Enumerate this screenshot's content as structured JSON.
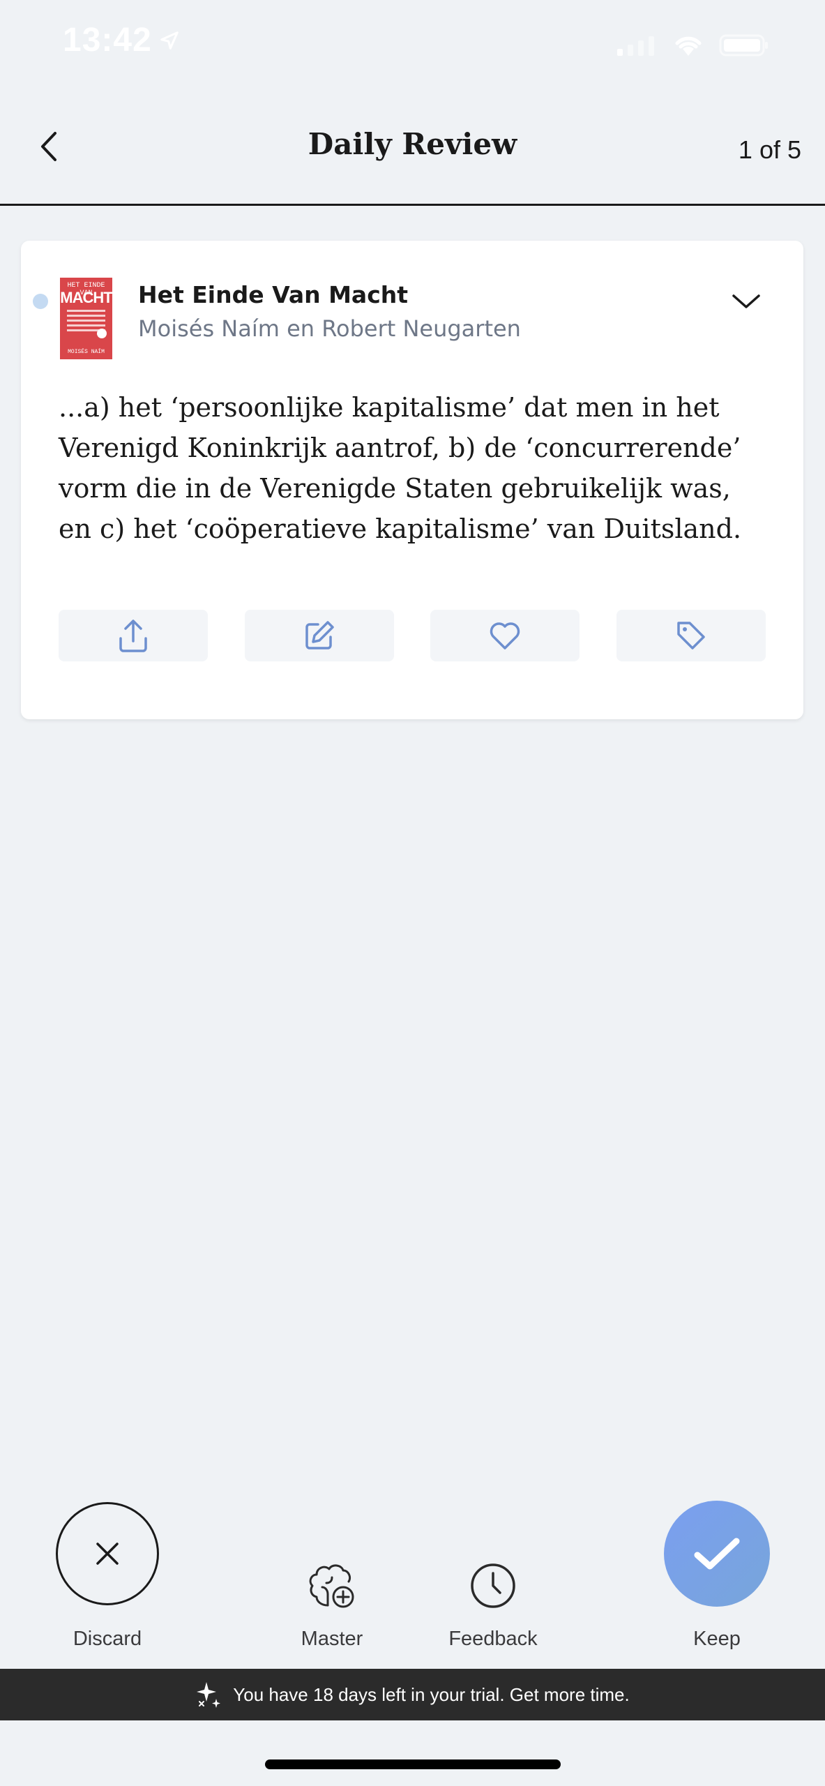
{
  "status_bar": {
    "time": "13:42"
  },
  "header": {
    "title": "Daily Review",
    "counter": "1 of 5"
  },
  "card": {
    "book_title": "Het Einde Van Macht",
    "book_author": "Moisés Naím en Robert Neugarten",
    "cover": {
      "top_text": "HET EINDE VAN",
      "main_text": "MACHT",
      "bottom_text": "MOISÉS NAÍM",
      "color": "#d9464a"
    },
    "quote": "...a) het ‘persoonlijke kapitalisme’ dat men in het Verenigd Koninkrijk aantrof, b) de ‘concurrerende’ vorm die in de Verenigde Staten gebruikelijk was, en c) het ‘coöperatieve kapitalisme’ van Duitsland.",
    "actions": [
      "share-icon",
      "edit-icon",
      "heart-icon",
      "tag-icon"
    ]
  },
  "bottom_actions": {
    "discard_label": "Discard",
    "master_label": "Master",
    "feedback_label": "Feedback",
    "keep_label": "Keep"
  },
  "banner": {
    "text": "You have 18 days left in your trial. Get more time."
  },
  "colors": {
    "background": "#eff2f5",
    "accent": "#6d8fcf",
    "keep_gradient_start": "#7a9ff0",
    "keep_gradient_end": "#78a5da",
    "banner_bg": "#2b2b2b"
  }
}
